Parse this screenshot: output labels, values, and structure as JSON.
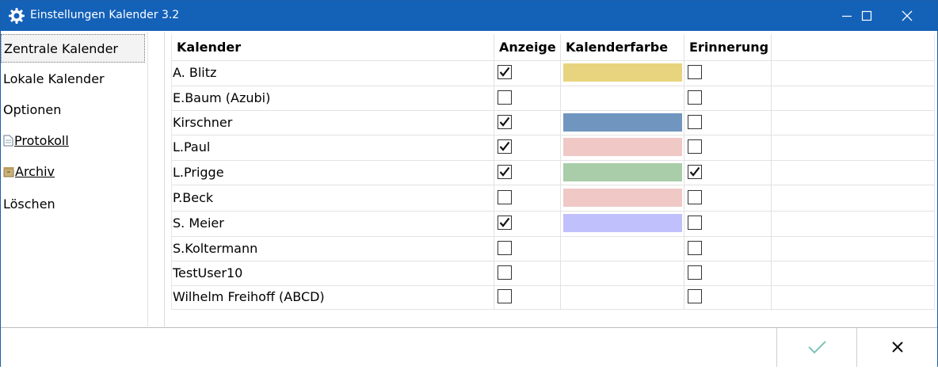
{
  "window": {
    "title": "Einstellungen Kalender 3.2"
  },
  "sidebar": {
    "items": [
      {
        "label": "Zentrale Kalender"
      },
      {
        "label": "Lokale Kalender"
      },
      {
        "label": "Optionen"
      },
      {
        "label": "Protokoll"
      },
      {
        "label": "Archiv"
      },
      {
        "label": "Löschen"
      }
    ]
  },
  "table": {
    "headers": {
      "kalender": "Kalender",
      "anzeige": "Anzeige",
      "farbe": "Kalenderfarbe",
      "erinnerung": "Erinnerung"
    },
    "rows": [
      {
        "name": "A. Blitz",
        "anzeige": true,
        "farbe": "#e8d47e",
        "erinnerung": false
      },
      {
        "name": "E.Baum (Azubi)",
        "anzeige": false,
        "farbe": "",
        "erinnerung": false
      },
      {
        "name": "Kirschner",
        "anzeige": true,
        "farbe": "#7096c0",
        "erinnerung": false
      },
      {
        "name": "L.Paul",
        "anzeige": true,
        "farbe": "#f0c8c6",
        "erinnerung": false
      },
      {
        "name": "L.Prigge",
        "anzeige": true,
        "farbe": "#a8cda8",
        "erinnerung": true
      },
      {
        "name": "P.Beck",
        "anzeige": false,
        "farbe": "#f0c8c6",
        "erinnerung": false
      },
      {
        "name": "S. Meier",
        "anzeige": true,
        "farbe": "#c0c0fc",
        "erinnerung": false
      },
      {
        "name": "S.Koltermann",
        "anzeige": false,
        "farbe": "",
        "erinnerung": false
      },
      {
        "name": "TestUser10",
        "anzeige": false,
        "farbe": "",
        "erinnerung": false
      },
      {
        "name": "Wilhelm Freihoff (ABCD)",
        "anzeige": false,
        "farbe": "",
        "erinnerung": false
      }
    ]
  },
  "colors": {
    "titlebar": "#1461b8",
    "ok_check": "#7fc4b8"
  }
}
